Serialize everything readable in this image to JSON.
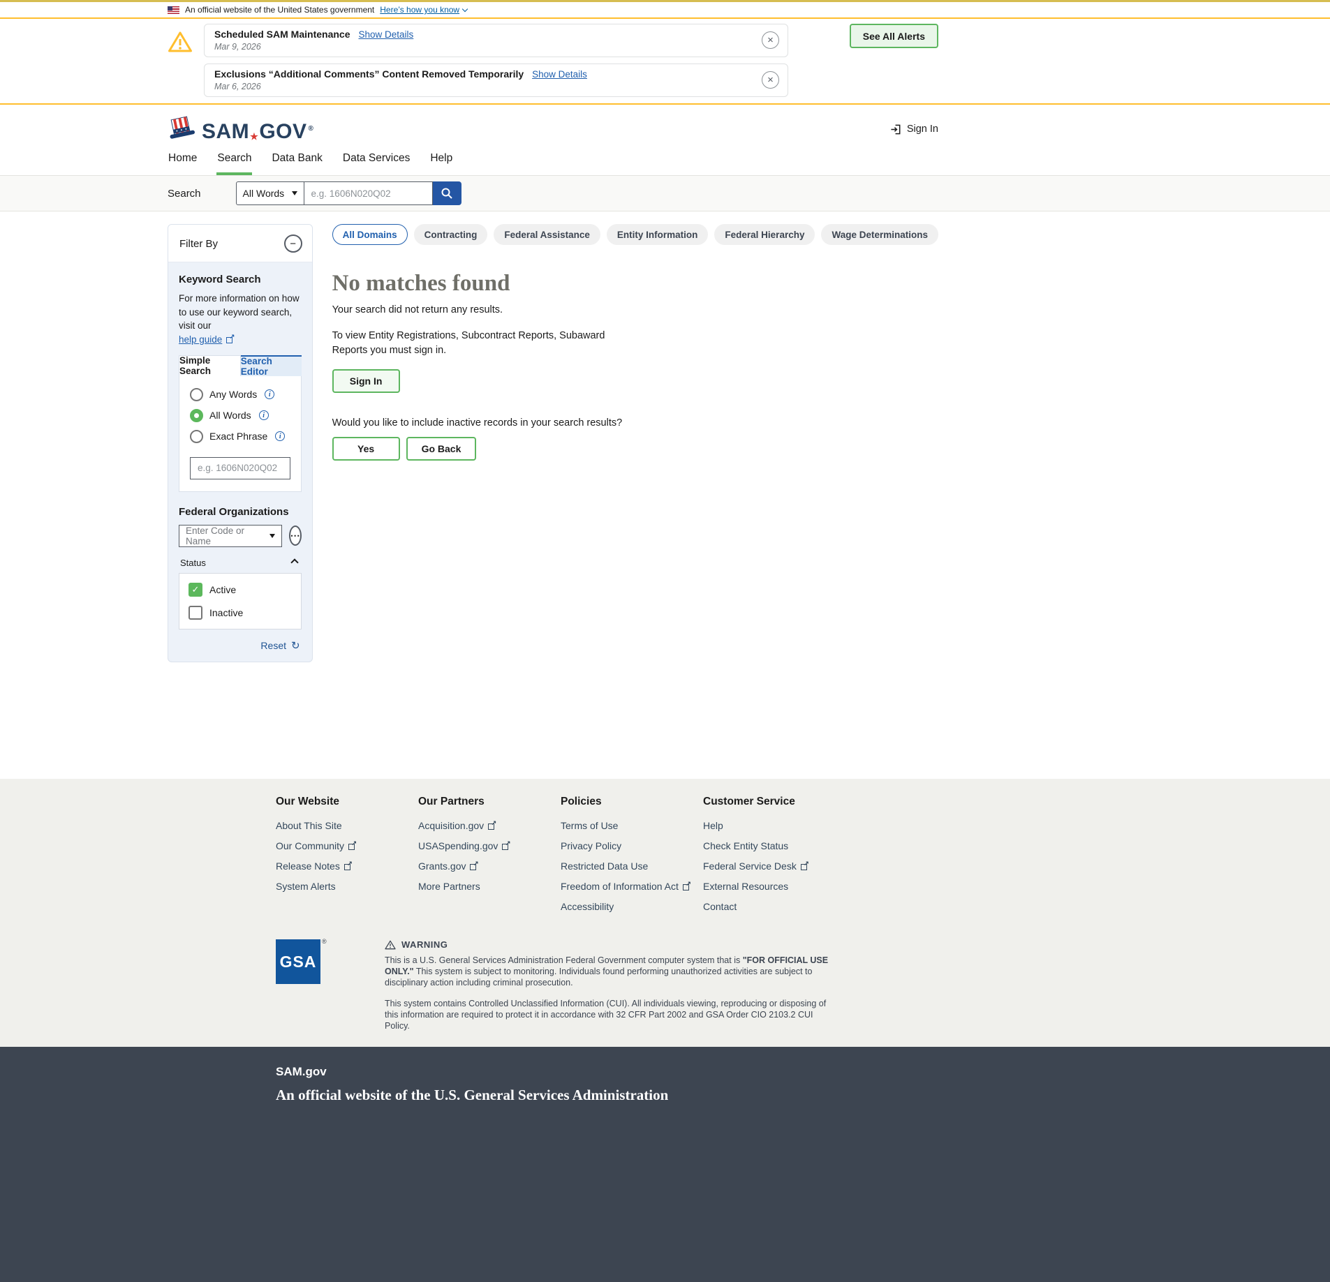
{
  "icons": {
    "close": "×",
    "collapse": "−",
    "ellipsis": "⋯",
    "reset": "↻",
    "info": "i",
    "star": "★",
    "registered": "®",
    "check": "✓"
  },
  "gov_banner": {
    "text": "An official website of the United States government",
    "link": "Here’s how you know"
  },
  "alerts": {
    "items": [
      {
        "title": "Scheduled SAM Maintenance",
        "details_link": "Show Details",
        "date": "Mar 9, 2026"
      },
      {
        "title": "Exclusions “Additional Comments” Content Removed Temporarily",
        "details_link": "Show Details",
        "date": "Mar 6, 2026"
      }
    ],
    "see_all_label": "See All Alerts"
  },
  "header": {
    "logo_sam": "SAM",
    "logo_gov": "GOV",
    "sign_in_label": "Sign In"
  },
  "nav": {
    "items": [
      {
        "label": "Home"
      },
      {
        "label": "Search"
      },
      {
        "label": "Data Bank"
      },
      {
        "label": "Data Services"
      },
      {
        "label": "Help"
      }
    ],
    "active": "Search"
  },
  "search_bar": {
    "label": "Search",
    "mode": "All Words",
    "placeholder": "e.g. 1606N020Q02"
  },
  "filter": {
    "title": "Filter By",
    "keyword_heading": "Keyword Search",
    "keyword_desc": "For more information on how to use our keyword search, visit our",
    "help_guide_label": "help guide",
    "tabs": [
      {
        "label": "Simple Search"
      },
      {
        "label": "Search Editor"
      }
    ],
    "active_tab": "Simple Search",
    "radios": [
      {
        "label": "Any Words"
      },
      {
        "label": "All Words"
      },
      {
        "label": "Exact Phrase"
      }
    ],
    "selected_radio": "All Words",
    "keyword_placeholder": "e.g. 1606N020Q02",
    "federal_orgs_heading": "Federal Organizations",
    "federal_orgs_placeholder": "Enter Code or Name",
    "status_heading": "Status",
    "checkboxes": [
      {
        "label": "Active",
        "checked": true
      },
      {
        "label": "Inactive",
        "checked": false
      }
    ],
    "reset_label": "Reset"
  },
  "results": {
    "domains": [
      {
        "label": "All Domains"
      },
      {
        "label": "Contracting"
      },
      {
        "label": "Federal Assistance"
      },
      {
        "label": "Entity Information"
      },
      {
        "label": "Federal Hierarchy"
      },
      {
        "label": "Wage Determinations"
      }
    ],
    "active_domain": "All Domains",
    "heading": "No matches found",
    "subheading": "Your search did not return any results.",
    "signin_note": "To view Entity Registrations, Subcontract Reports, Subaward Reports you must sign in.",
    "sign_in_button": "Sign In",
    "inactive_question": "Would you like to include inactive records in your search results?",
    "yes_button": "Yes",
    "go_back_button": "Go Back"
  },
  "footer": {
    "columns": [
      {
        "title": "Our Website",
        "links": [
          {
            "label": "About This Site",
            "external": false
          },
          {
            "label": "Our Community",
            "external": true
          },
          {
            "label": "Release Notes",
            "external": true
          },
          {
            "label": "System Alerts",
            "external": false
          }
        ]
      },
      {
        "title": "Our Partners",
        "links": [
          {
            "label": "Acquisition.gov",
            "external": true
          },
          {
            "label": "USASpending.gov",
            "external": true
          },
          {
            "label": "Grants.gov",
            "external": true
          },
          {
            "label": "More Partners",
            "external": false
          }
        ]
      },
      {
        "title": "Policies",
        "links": [
          {
            "label": "Terms of Use",
            "external": false
          },
          {
            "label": "Privacy Policy",
            "external": false
          },
          {
            "label": "Restricted Data Use",
            "external": false
          },
          {
            "label": "Freedom of Information Act",
            "external": true
          },
          {
            "label": "Accessibility",
            "external": false
          }
        ]
      },
      {
        "title": "Customer Service",
        "links": [
          {
            "label": "Help",
            "external": false
          },
          {
            "label": "Check Entity Status",
            "external": false
          },
          {
            "label": "Federal Service Desk",
            "external": true
          },
          {
            "label": "External Resources",
            "external": false
          },
          {
            "label": "Contact",
            "external": false
          }
        ]
      }
    ],
    "gsa_label": "GSA",
    "warning_heading": "WARNING",
    "warning_p1_start": "This is a U.S. General Services Administration Federal Government computer system that is ",
    "warning_p1_bold": "\"FOR OFFICIAL USE ONLY.\"",
    "warning_p1_end": " This system is subject to monitoring. Individuals found performing unauthorized activities are subject to disciplinary action including criminal prosecution.",
    "warning_p2": "This system contains Controlled Unclassified Information (CUI). All individuals viewing, reproducing or disposing of this information are required to protect it in accordance with 32 CFR Part 2002 and GSA Order CIO 2103.2 CUI Policy.",
    "site_name": "SAM.gov",
    "tagline": "An official website of the U.S. General Services Administration"
  }
}
